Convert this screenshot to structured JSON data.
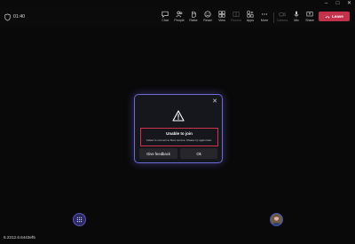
{
  "call": {
    "timer": "01:40",
    "toolbar": {
      "chat": "Chat",
      "people": "People",
      "raise": "Raise",
      "react": "React",
      "view": "View",
      "rooms": "Rooms",
      "apps": "Apps",
      "more": "More",
      "camera": "Camera",
      "mic": "Mic",
      "share": "Share",
      "leave": "Leave"
    }
  },
  "dialog": {
    "title": "Unable to join",
    "message": "Failed to connect to Boot service. Please try again later.",
    "feedback_label": "Give feedback",
    "ok_label": "Ok"
  },
  "footer": {
    "version": "5.2312.6.6443ef5"
  }
}
